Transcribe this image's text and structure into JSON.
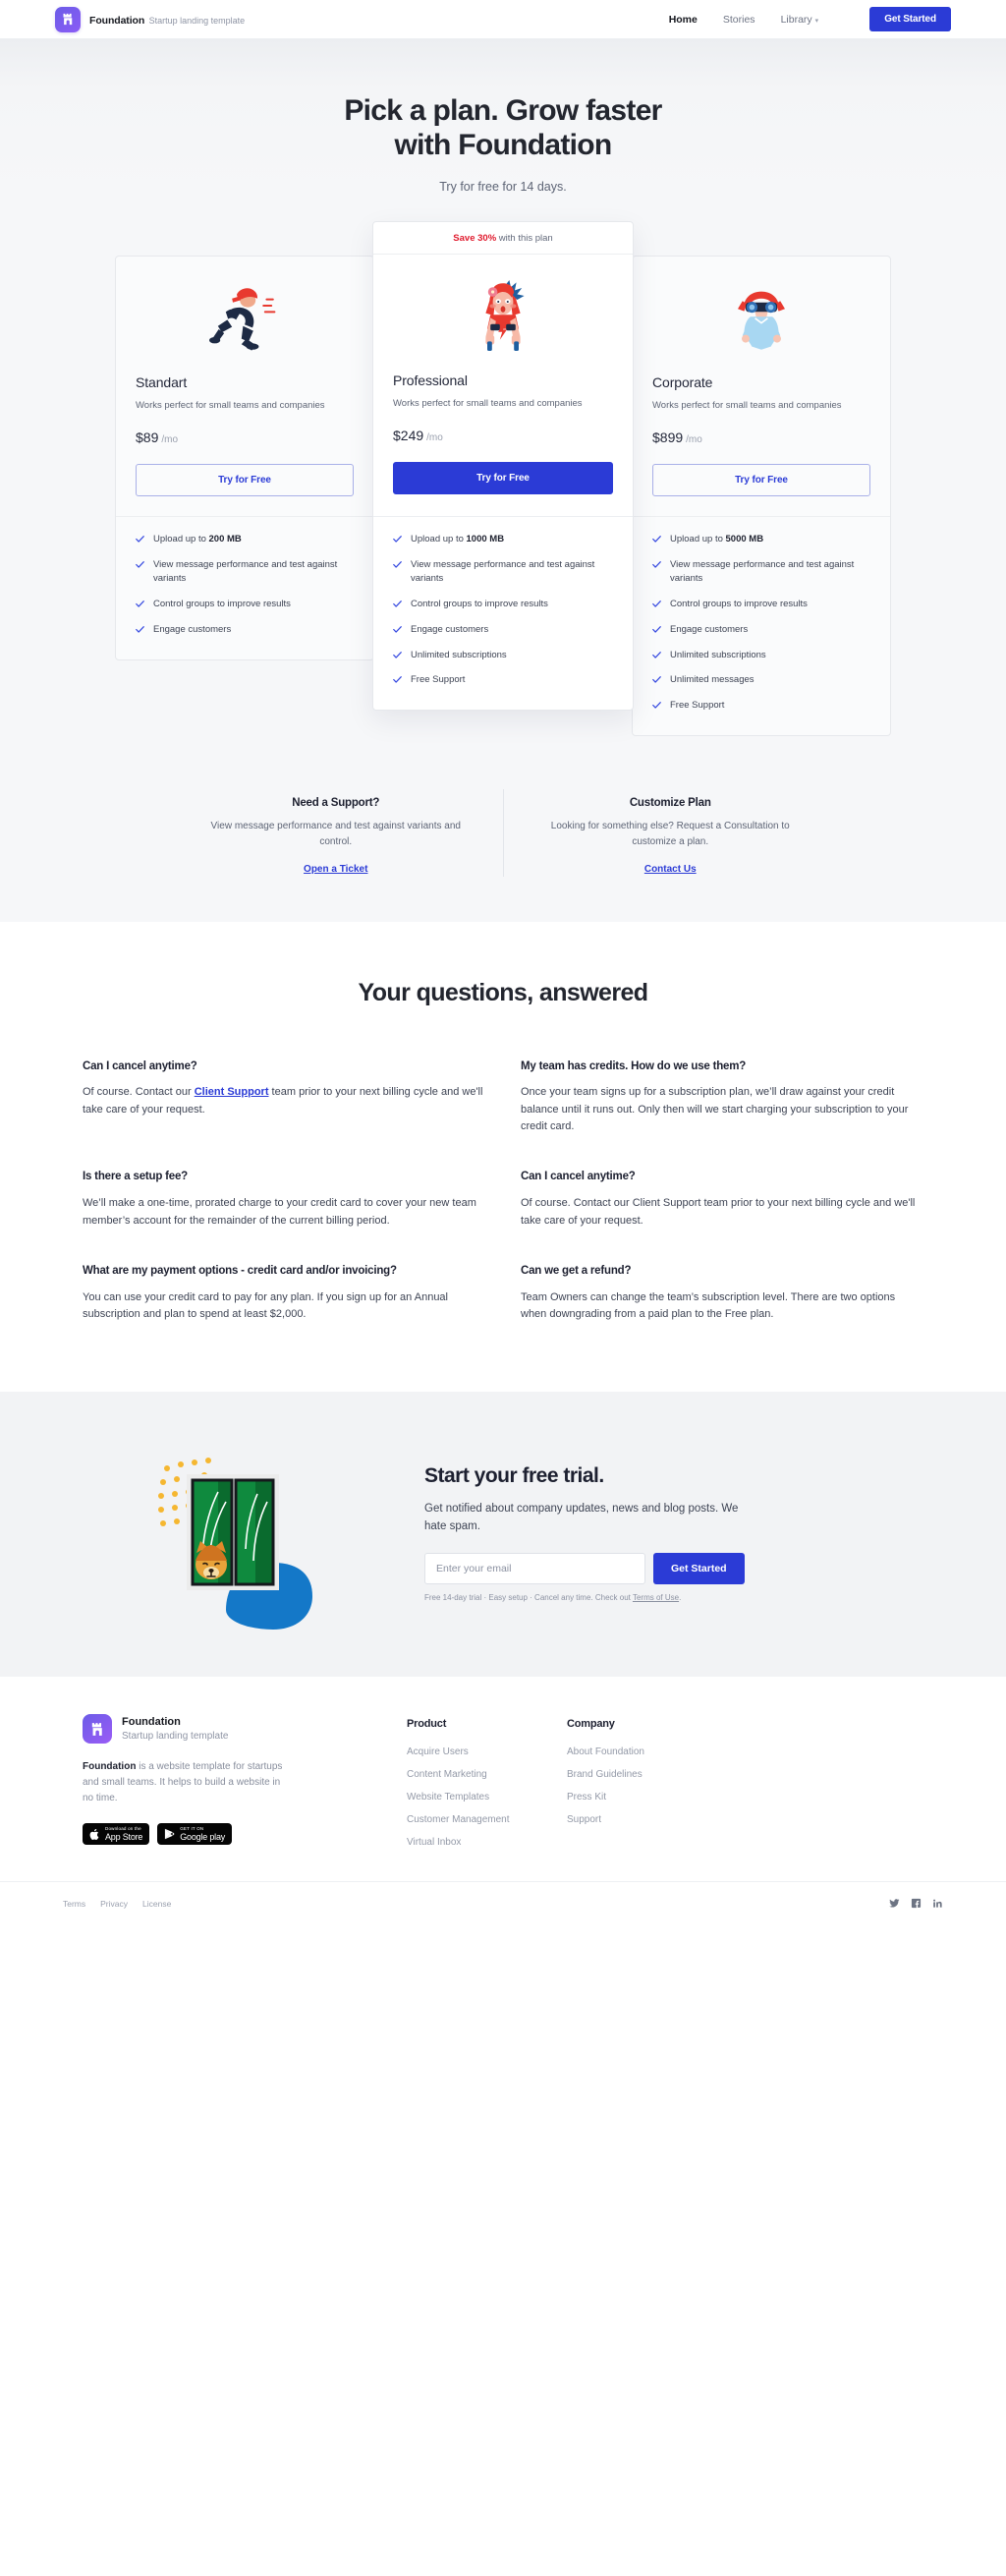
{
  "nav": {
    "brand_title": "Foundation",
    "brand_subtitle": "Startup landing template",
    "links": [
      {
        "label": "Home",
        "active": true
      },
      {
        "label": "Stories",
        "active": false
      },
      {
        "label": "Library",
        "active": false,
        "caret": true
      }
    ],
    "cta_label": "Get Started"
  },
  "hero": {
    "title_line1": "Pick a plan. Grow faster",
    "title_line2": "with Foundation",
    "subtitle": "Try for free for 14 days."
  },
  "pricing": {
    "save_badge_bold": "Save 30%",
    "save_badge_rest": " with this plan",
    "plans": [
      {
        "name": "Standart",
        "desc": "Works perfect for small teams and companies",
        "price": "$89",
        "per": "/mo",
        "button": "Try for Free",
        "features": [
          {
            "pre": "Upload up to ",
            "bold": "200 MB",
            "post": ""
          },
          {
            "pre": "View message performance and test against variants",
            "bold": "",
            "post": ""
          },
          {
            "pre": "Control groups to improve results",
            "bold": "",
            "post": ""
          },
          {
            "pre": "Engage customers",
            "bold": "",
            "post": ""
          }
        ]
      },
      {
        "name": "Professional",
        "desc": "Works perfect for small teams and companies",
        "price": "$249",
        "per": "/mo",
        "button": "Try for Free",
        "features": [
          {
            "pre": "Upload up to ",
            "bold": "1000 MB",
            "post": ""
          },
          {
            "pre": "View message performance and test against variants",
            "bold": "",
            "post": ""
          },
          {
            "pre": "Control groups to improve results",
            "bold": "",
            "post": ""
          },
          {
            "pre": "Engage customers",
            "bold": "",
            "post": ""
          },
          {
            "pre": "Unlimited subscriptions",
            "bold": "",
            "post": ""
          },
          {
            "pre": "Free Support",
            "bold": "",
            "post": ""
          }
        ]
      },
      {
        "name": "Corporate",
        "desc": "Works perfect for small teams and companies",
        "price": "$899",
        "per": "/mo",
        "button": "Try for Free",
        "features": [
          {
            "pre": "Upload up to ",
            "bold": "5000 MB",
            "post": ""
          },
          {
            "pre": "View message performance and test against variants",
            "bold": "",
            "post": ""
          },
          {
            "pre": "Control groups to improve results",
            "bold": "",
            "post": ""
          },
          {
            "pre": "Engage customers",
            "bold": "",
            "post": ""
          },
          {
            "pre": "Unlimited subscriptions",
            "bold": "",
            "post": ""
          },
          {
            "pre": "Unlimited messages",
            "bold": "",
            "post": ""
          },
          {
            "pre": "Free Support",
            "bold": "",
            "post": ""
          }
        ]
      }
    ]
  },
  "support": {
    "left_title": "Need a Support?",
    "left_text": "View message performance and test against variants and control.",
    "left_link": "Open a Ticket",
    "right_title": "Customize Plan",
    "right_text": "Looking for something else? Request a Consultation to customize a plan.",
    "right_link": "Contact Us"
  },
  "faq": {
    "title": "Your questions, answered",
    "items": [
      {
        "q": "Can I cancel anytime?",
        "a_pre": "Of course. Contact our ",
        "a_link": "Client Support",
        "a_post": " team prior to your next billing cycle and we'll take care of your request."
      },
      {
        "q": "My team has credits. How do we use them?",
        "a_pre": "Once your team signs up for a subscription plan, we’ll draw against your credit balance until it runs out. Only then will we start charging your subscription to your credit card.",
        "a_link": "",
        "a_post": ""
      },
      {
        "q": "Is there a setup fee?",
        "a_pre": "We’ll make a one-time, prorated charge to your credit card to cover your new team member’s account for the remainder of the current billing period.",
        "a_link": "",
        "a_post": ""
      },
      {
        "q": "Can I cancel anytime?",
        "a_pre": "Of course. Contact our Client Support team prior to your next billing cycle and we'll take care of your request.",
        "a_link": "",
        "a_post": ""
      },
      {
        "q": "What are my payment options - credit card and/or invoicing?",
        "a_pre": "You can use your credit card to pay for any plan. If you sign up for an Annual subscription and plan to spend at least $2,000.",
        "a_link": "",
        "a_post": ""
      },
      {
        "q": "Can we get a refund?",
        "a_pre": "Team Owners can change the team’s subscription level. There are two options when downgrading from a paid plan to the Free plan.",
        "a_link": "",
        "a_post": ""
      }
    ]
  },
  "cta": {
    "title": "Start your free trial.",
    "text": "Get notified about company updates, news and blog posts. We hate spam.",
    "input_placeholder": "Enter your email",
    "input_value": "",
    "button": "Get Started",
    "fine_pre": "Free 14-day trial · Easy setup · Cancel any time. Check out ",
    "fine_link": "Terms of Use",
    "fine_post": "."
  },
  "footer": {
    "brand_title": "Foundation",
    "brand_subtitle": "Startup landing template",
    "desc_bold": "Foundation",
    "desc_rest": " is a website template for startups and small teams. It helps to build a website in no time.",
    "appstore_small": "Download on the",
    "appstore_big": "App Store",
    "googleplay_small": "GET IT ON",
    "googleplay_big": "Google play",
    "col_product_head": "Product",
    "col_product_links": [
      "Acquire Users",
      "Content Marketing",
      "Website Templates",
      "Customer Management",
      "Virtual Inbox"
    ],
    "col_company_head": "Company",
    "col_company_links": [
      "About Foundation",
      "Brand Guidelines",
      "Press Kit",
      "Support"
    ],
    "legal": [
      "Terms",
      "Privacy",
      "License"
    ],
    "socials": [
      "twitter-icon",
      "facebook-icon",
      "linkedin-icon"
    ]
  },
  "colors": {
    "accent": "#2b3bd6",
    "sale_red": "#e01b2e",
    "page_bg": "#f6f7f9",
    "text_dark": "#1d2030",
    "muted": "#8e94a4"
  }
}
